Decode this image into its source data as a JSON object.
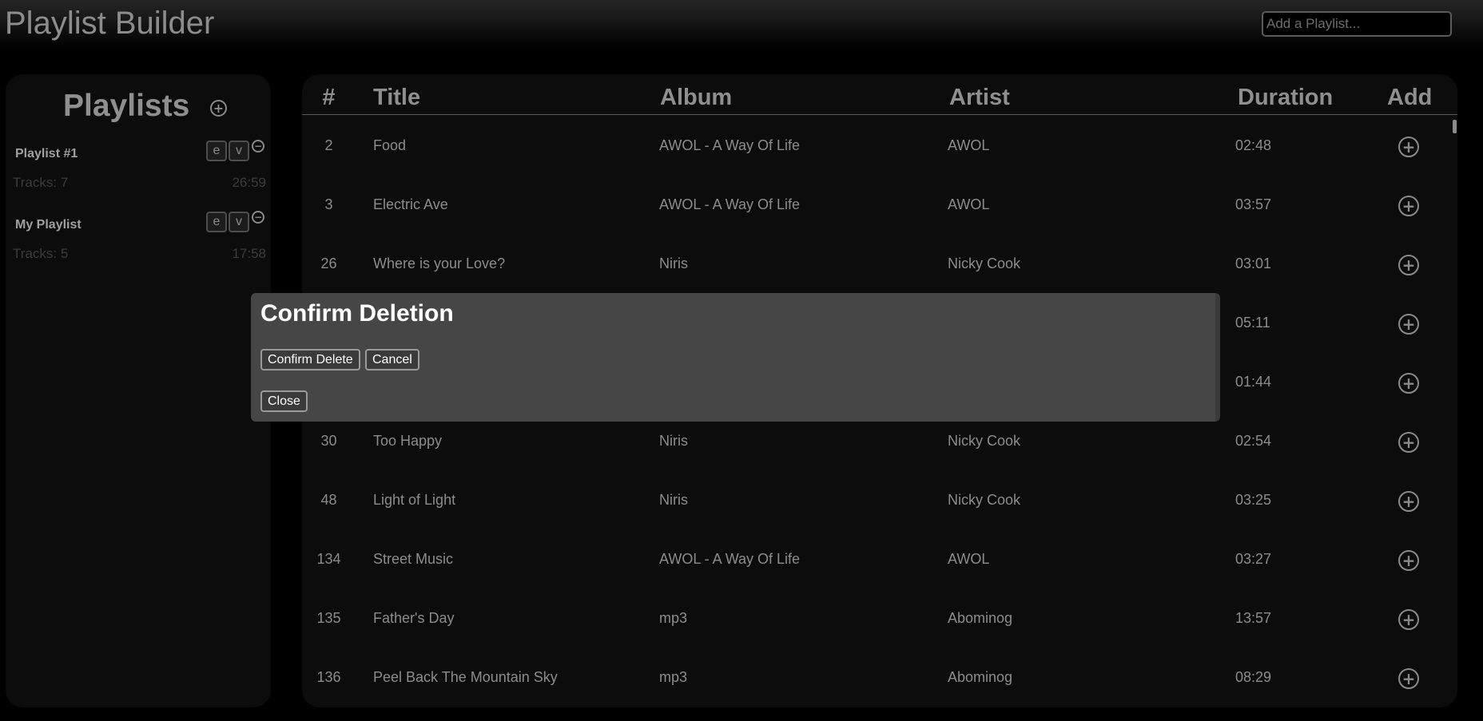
{
  "header": {
    "title": "Playlist Builder",
    "add_placeholder": "Add a Playlist..."
  },
  "sidebar": {
    "title": "Playlists",
    "playlists": [
      {
        "name": "Playlist #1",
        "edit_label": "e",
        "view_label": "v",
        "tracks": "Tracks: 7",
        "duration": "26:59"
      },
      {
        "name": "My Playlist",
        "edit_label": "e",
        "view_label": "v",
        "tracks": "Tracks: 5",
        "duration": "17:58"
      }
    ]
  },
  "table": {
    "headers": {
      "num": "#",
      "title": "Title",
      "album": "Album",
      "artist": "Artist",
      "duration": "Duration",
      "add": "Add"
    },
    "rows": [
      {
        "num": "2",
        "title": "Food",
        "album": "AWOL - A Way Of Life",
        "artist": "AWOL",
        "duration": "02:48"
      },
      {
        "num": "3",
        "title": "Electric Ave",
        "album": "AWOL - A Way Of Life",
        "artist": "AWOL",
        "duration": "03:57"
      },
      {
        "num": "26",
        "title": "Where is your Love?",
        "album": "Niris",
        "artist": "Nicky Cook",
        "duration": "03:01"
      },
      {
        "num": "",
        "title": "",
        "album": "",
        "artist": "",
        "duration": "05:11"
      },
      {
        "num": "",
        "title": "",
        "album": "",
        "artist": "",
        "duration": "01:44"
      },
      {
        "num": "30",
        "title": "Too Happy",
        "album": "Niris",
        "artist": "Nicky Cook",
        "duration": "02:54"
      },
      {
        "num": "48",
        "title": "Light of Light",
        "album": "Niris",
        "artist": "Nicky Cook",
        "duration": "03:25"
      },
      {
        "num": "134",
        "title": "Street Music",
        "album": "AWOL - A Way Of Life",
        "artist": "AWOL",
        "duration": "03:27"
      },
      {
        "num": "135",
        "title": "Father's Day",
        "album": "mp3",
        "artist": "Abominog",
        "duration": "13:57"
      },
      {
        "num": "136",
        "title": "Peel Back The Mountain Sky",
        "album": "mp3",
        "artist": "Abominog",
        "duration": "08:29"
      }
    ]
  },
  "modal": {
    "title": "Confirm Deletion",
    "confirm_label": "Confirm Delete",
    "cancel_label": "Cancel",
    "close_label": "Close"
  },
  "icons": {
    "add_glyph": "+",
    "remove_glyph": "−"
  },
  "colors": {
    "background": "#000000",
    "panel": "#0c0c0c",
    "modal": "#464646",
    "text": "#8c8c8c"
  }
}
